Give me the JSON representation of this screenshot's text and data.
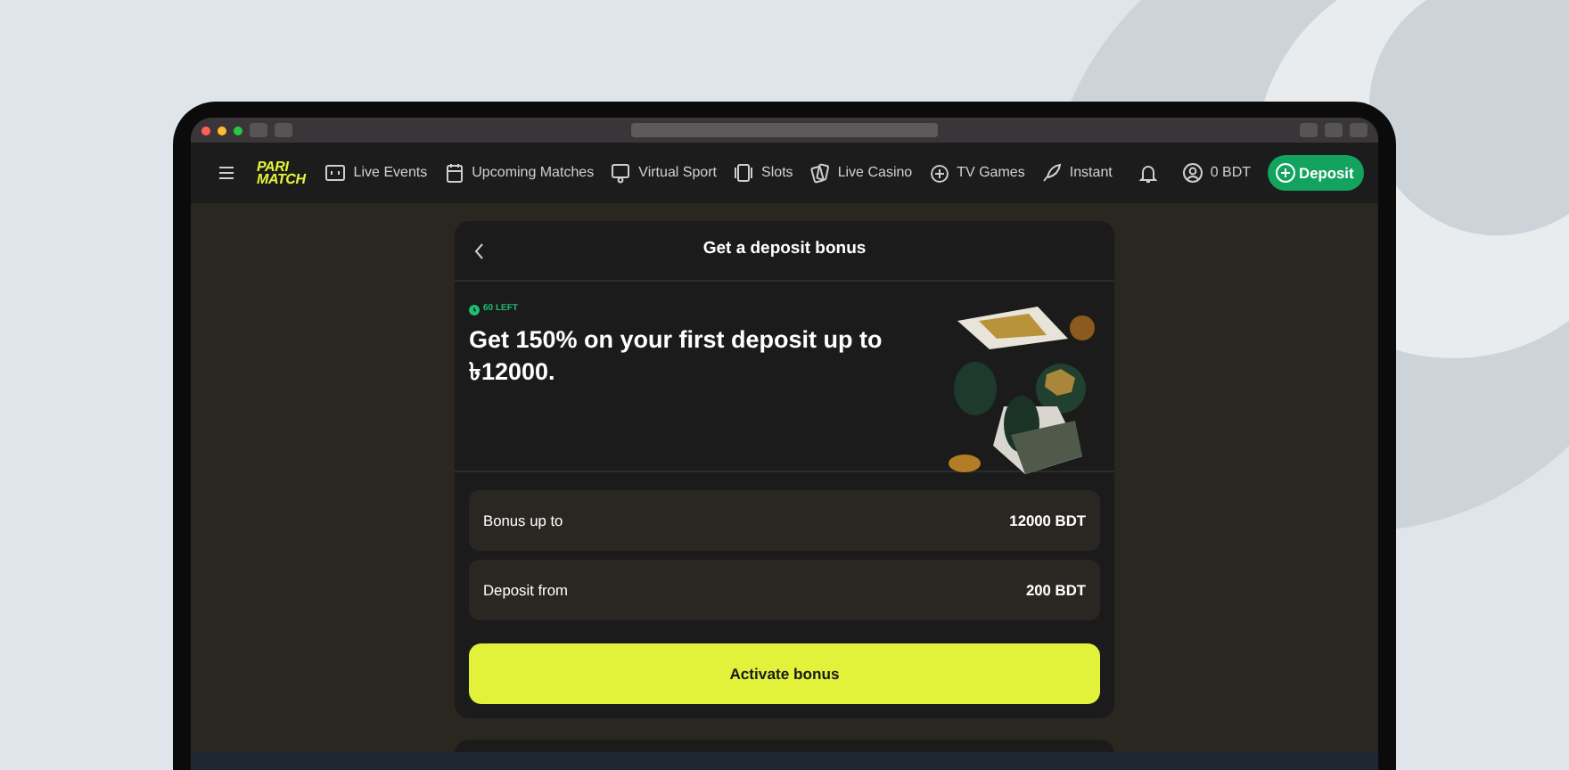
{
  "navbar": {
    "logo": [
      "PARI",
      "MATCH"
    ],
    "items": [
      {
        "label": "Live Events"
      },
      {
        "label": "Upcoming Matches"
      },
      {
        "label": "Virtual Sport"
      },
      {
        "label": "Slots"
      },
      {
        "label": "Live Casino"
      },
      {
        "label": "TV Games"
      },
      {
        "label": "Instant"
      }
    ],
    "balance": "0 BDT",
    "deposit_button": "Deposit"
  },
  "bonus_card": {
    "title": "Get a deposit bonus",
    "timer": "60 LEFT",
    "headline": "Get 150% on your first deposit up to ৳12000.",
    "rows": [
      {
        "label": "Bonus up to",
        "value": "12000 BDT"
      },
      {
        "label": "Deposit from",
        "value": "200 BDT"
      }
    ],
    "button": "Activate bonus"
  }
}
